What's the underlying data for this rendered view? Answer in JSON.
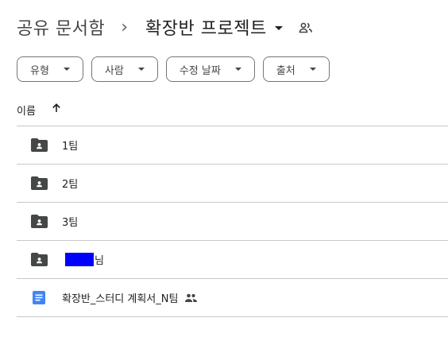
{
  "breadcrumb": {
    "parent": "공유 문서함",
    "separator": "›",
    "current": "확장반 프로젝트"
  },
  "filters": [
    {
      "label": "유형"
    },
    {
      "label": "사람"
    },
    {
      "label": "수정 날짜"
    },
    {
      "label": "출처"
    }
  ],
  "columns": {
    "name_label": "이름"
  },
  "items": [
    {
      "name": "1팀",
      "type": "folder"
    },
    {
      "name": "2팀",
      "type": "folder"
    },
    {
      "name": "3팀",
      "type": "folder"
    },
    {
      "name_prefix": "",
      "name_suffix": "님",
      "type": "folder",
      "redacted": true
    },
    {
      "name": "확장반_스터디 계획서_N팀",
      "type": "doc",
      "shared": true
    }
  ],
  "colors": {
    "folder": "#444746",
    "doc": "#4285f4",
    "redaction": "#0000ff",
    "divider": "#c7c7c7"
  }
}
